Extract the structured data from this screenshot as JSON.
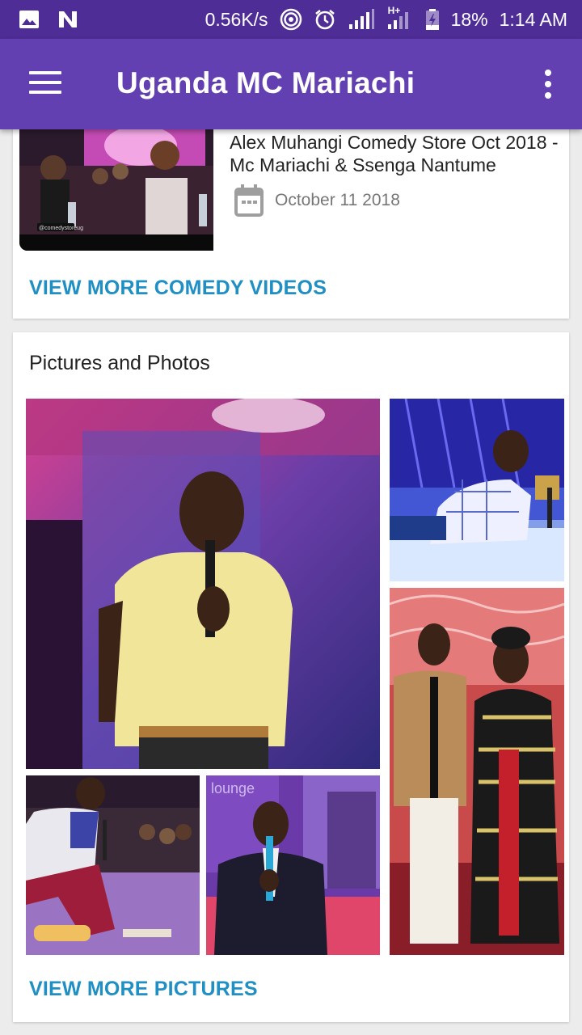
{
  "status_bar": {
    "speed": "0.56K/s",
    "network": "H+",
    "battery": "18%",
    "time": "1:14 AM",
    "icons": [
      "image-icon",
      "n-icon",
      "hotspot-icon",
      "alarm-icon",
      "signal-icon",
      "signal-icon",
      "battery-icon"
    ]
  },
  "app_bar": {
    "title": "Uganda MC Mariachi",
    "icons": [
      "menu-icon",
      "more-vert-icon"
    ]
  },
  "comedy_card": {
    "video": {
      "title": "Alex Muhangi Comedy Store Oct 2018 - Mc Mariachi & Ssenga Nantume",
      "date": "October 11 2018",
      "thumb_caption": "@comedystoreug"
    },
    "view_more": "VIEW MORE COMEDY VIDEOS"
  },
  "pictures_card": {
    "title": "Pictures and Photos",
    "photos": [
      "photo-comedian-yellow-shirt",
      "photo-comedian-lying-stage",
      "photo-wedding-couple",
      "photo-comedian-kneeling",
      "photo-comedian-lounge"
    ],
    "photo_text": {
      "lounge_sign": "lounge"
    },
    "view_more": "VIEW MORE PICTURES"
  },
  "colors": {
    "status_bar": "#4f2d96",
    "app_bar": "#6340b2",
    "link": "#1f8fc4",
    "background": "#ececec"
  }
}
